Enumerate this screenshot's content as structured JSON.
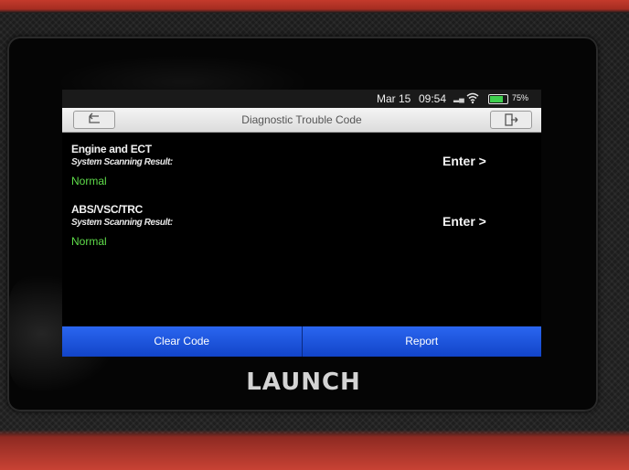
{
  "status": {
    "date": "Mar 15",
    "time": "09:54",
    "signal_icon": "signal-icon",
    "battery_percent": "75%",
    "battery_level": 0.75
  },
  "titlebar": {
    "title": "Diagnostic Trouble Code",
    "back_icon": "back-arrow-icon",
    "exit_icon": "exit-icon"
  },
  "systems": [
    {
      "name": "Engine and ECT",
      "subtitle": "System Scanning Result:",
      "status": "Normal",
      "enter_label": "Enter >"
    },
    {
      "name": "ABS/VSC/TRC",
      "subtitle": "System Scanning Result:",
      "status": "Normal",
      "enter_label": "Enter >"
    }
  ],
  "bottom_bar": {
    "clear_code_label": "Clear Code",
    "report_label": "Report"
  },
  "device": {
    "brand": "LAUNCH"
  },
  "colors": {
    "accent_blue": "#1a55e0",
    "status_green": "#5fdc4a",
    "device_red": "#c43a2c"
  }
}
